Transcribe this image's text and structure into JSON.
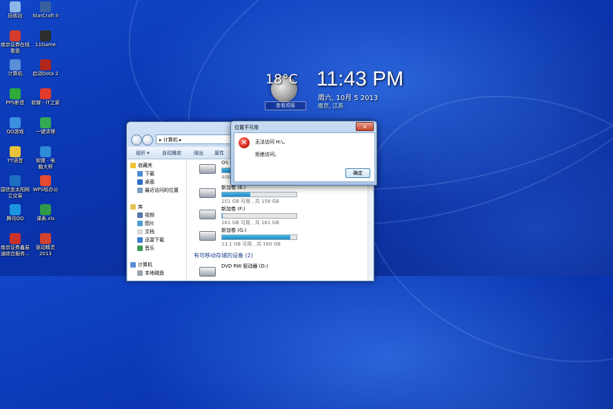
{
  "desktop": {
    "icons": [
      {
        "label": "回收站",
        "color": "#8fb6e8"
      },
      {
        "label": "StarCraft II",
        "color": "#3a5fa0"
      },
      {
        "label": "南京证券在线\n看盘",
        "color": "#d33b2a"
      },
      {
        "label": "11Game",
        "color": "#2c2c2c"
      },
      {
        "label": "计算机",
        "color": "#5b8fd6"
      },
      {
        "label": "启动Dota 2",
        "color": "#b1261c"
      },
      {
        "label": "PPS影音",
        "color": "#2eaa3a"
      },
      {
        "label": "软媒 - IT之家",
        "color": "#e03a2d"
      },
      {
        "label": "QQ游戏",
        "color": "#3c90e0"
      },
      {
        "label": "一键清理",
        "color": "#34a852"
      },
      {
        "label": "YY语音",
        "color": "#e8c23a"
      },
      {
        "label": "软媒 - 电\n脑大师",
        "color": "#2d8ad8"
      },
      {
        "label": "国信金太阳网\n立交易",
        "color": "#1c6ec2"
      },
      {
        "label": "WPS轻办公",
        "color": "#e34a2f"
      },
      {
        "label": "腾讯QQ",
        "color": "#1b95e0"
      },
      {
        "label": "课表.xls",
        "color": "#2f9a4a"
      },
      {
        "label": "南京证券鑫易\n通综合服务...",
        "color": "#c9322a"
      },
      {
        "label": "驱动精灵\n2013",
        "color": "#d14330"
      }
    ]
  },
  "weather_gadget": {
    "temperature": "18°C",
    "link_label": "查看预报"
  },
  "clock_gadget": {
    "time": "11:43 PM",
    "date": "周六, 10月 5 2013",
    "city": "南京, 江苏"
  },
  "explorer": {
    "address": "▸ 计算机 ▸",
    "toolbar": {
      "organize": "组织 ▾",
      "autoplay": "自动播放",
      "eject": "弹出",
      "properties": "属性"
    },
    "nav": {
      "favorites": "收藏夹",
      "downloads": "下载",
      "desktop": "桌面",
      "recent": "最近访问的位置",
      "libraries": "库",
      "videos": "视频",
      "pictures": "图片",
      "documents": "文档",
      "thunder": "迅雷下载",
      "music": "音乐",
      "computer": "计算机",
      "local_disk": "本地磁盘"
    },
    "drives": [
      {
        "name": "OS (C:)",
        "size": "406 GB 可用 , 共 ...",
        "used_fraction": 0.35
      },
      {
        "name": "新加卷 (E:)",
        "size": "101 GB 可用 , 共 158 GB",
        "used_fraction": 0.38
      },
      {
        "name": "新加卷 (F:)",
        "size": "161 GB 可用 , 共 161 GB",
        "used_fraction": 0.01
      },
      {
        "name": "新加卷 (G:)",
        "size": "13.1 GB 可用 , 共 160 GB",
        "used_fraction": 0.92
      }
    ],
    "removable_section": "有可移动存储的设备 (2)",
    "dvd": {
      "name": "DVD RW 驱动器 (D:)"
    }
  },
  "dialog": {
    "title": "位置不可用",
    "message_1": "无法访问 H:\\。",
    "message_2": "拒绝访问。",
    "ok_label": "确定",
    "close_glyph": "x"
  }
}
